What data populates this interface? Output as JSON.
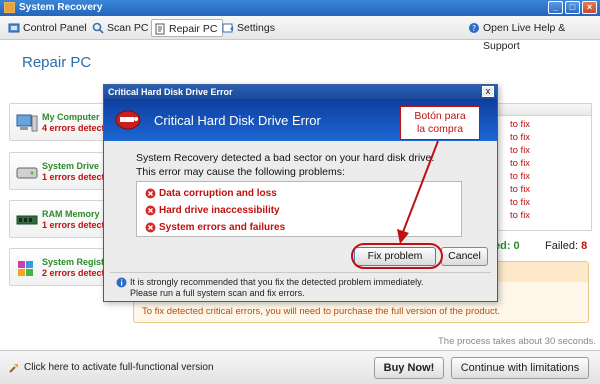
{
  "window": {
    "title": "System Recovery"
  },
  "toolbar": {
    "items": [
      {
        "label": "Control Panel",
        "icon": "control-panel-icon"
      },
      {
        "label": "Scan PC",
        "icon": "scan-icon"
      },
      {
        "label": "Repair PC",
        "icon": "repair-icon",
        "active": true
      },
      {
        "label": "Settings",
        "icon": "settings-icon"
      }
    ],
    "help_label": "Open Live Help & Support"
  },
  "page": {
    "title": "Repair PC"
  },
  "status_cards": [
    {
      "name": "My Computer",
      "errors": "4 errors detect",
      "icon": "computer-icon"
    },
    {
      "name": "System Drive",
      "errors": "1 errors detecte",
      "icon": "drive-icon"
    },
    {
      "name": "RAM Memory",
      "errors": "1 errors detecte",
      "icon": "memory-icon"
    },
    {
      "name": "System Registr",
      "errors": "2 errors detecte",
      "icon": "registry-icon"
    }
  ],
  "results": {
    "rows": [
      "to fix",
      "to fix",
      "to fix",
      "to fix",
      "to fix",
      "to fix",
      "to fix",
      "to fix"
    ],
    "fixed_label": "ed: 0",
    "failed_label": "Failed:",
    "failed_value": "8"
  },
  "purchase_message": "To fix detected critical errors, you will need to purchase the full version of the product.",
  "process_time": "The process takes about 30 seconds.",
  "bottom": {
    "activate_label": "Click here to activate full-functional version",
    "buy_label": "Buy Now!",
    "continue_label": "Continue with limitations"
  },
  "dialog": {
    "title": "Critical Hard Disk Drive Error",
    "close_label": "x",
    "header": "Critical Hard Disk Drive Error",
    "message_line1": "System Recovery detected a bad sector on your hard disk drive.",
    "message_line2": "This error may cause the following problems:",
    "problems": [
      "Data corruption and loss",
      "Hard drive inaccessibility",
      "System errors and failures"
    ],
    "fix_label": "Fix problem",
    "cancel_label": "Cancel",
    "note_line1": "It is strongly recommended that you fix the detected problem immediately.",
    "note_line2": "Please run a full system scan and fix errors."
  },
  "annotation": {
    "callout_line1": "Botón para",
    "callout_line2": "la compra",
    "color": "#c01010"
  }
}
